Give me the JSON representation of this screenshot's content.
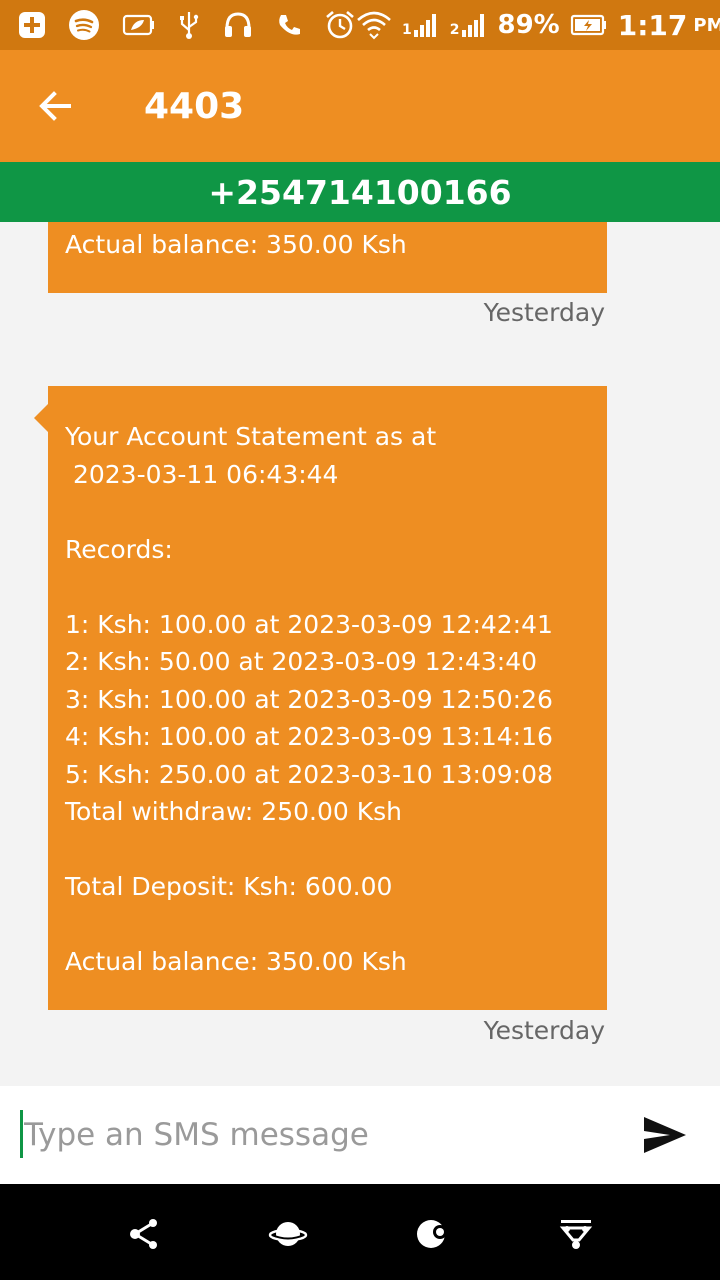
{
  "status_bar": {
    "battery_percent": "89%",
    "time": "1:17",
    "ampm": "PM",
    "sim1": "1",
    "sim2": "2",
    "icons": [
      "plus-square-icon",
      "spotify-icon",
      "battery-saver-icon",
      "usb-icon",
      "headset-icon",
      "call-icon",
      "alarm-icon",
      "wifi-icon",
      "signal-sim1-icon",
      "signal-sim2-icon",
      "battery-charging-icon"
    ]
  },
  "app_bar": {
    "title": "4403",
    "back_icon": "arrow-left-icon"
  },
  "number_bar": {
    "phone": "+254714100166"
  },
  "messages": [
    {
      "lines": [
        "Actual balance: 350.00 Ksh"
      ],
      "timestamp": "Yesterday"
    },
    {
      "lines": [
        "Your Account Statement as at",
        " 2023-03-11 06:43:44",
        "",
        "Records:",
        "",
        "1: Ksh: 100.00 at 2023-03-09 12:42:41",
        "2: Ksh: 50.00 at 2023-03-09 12:43:40",
        "3: Ksh: 100.00 at 2023-03-09 12:50:26",
        "4: Ksh: 100.00 at 2023-03-09 13:14:16",
        "5: Ksh: 250.00 at 2023-03-10 13:09:08",
        "Total withdraw: 250.00 Ksh",
        "",
        "Total Deposit: Ksh: 600.00",
        "",
        "Actual balance: 350.00 Ksh"
      ],
      "timestamp": "Yesterday"
    }
  ],
  "composer": {
    "placeholder": "Type an SMS message",
    "value": "",
    "send_icon": "send-icon"
  },
  "nav_bar": {
    "icons": [
      "nav-share-icon",
      "nav-planet-icon",
      "nav-moon-icon",
      "nav-filter-icon"
    ]
  },
  "colors": {
    "status_bar": "#d07810",
    "app_bar": "#ee8e22",
    "number_bar": "#0f9645",
    "bubble": "#ee8e22",
    "background": "#f3f3f3"
  }
}
